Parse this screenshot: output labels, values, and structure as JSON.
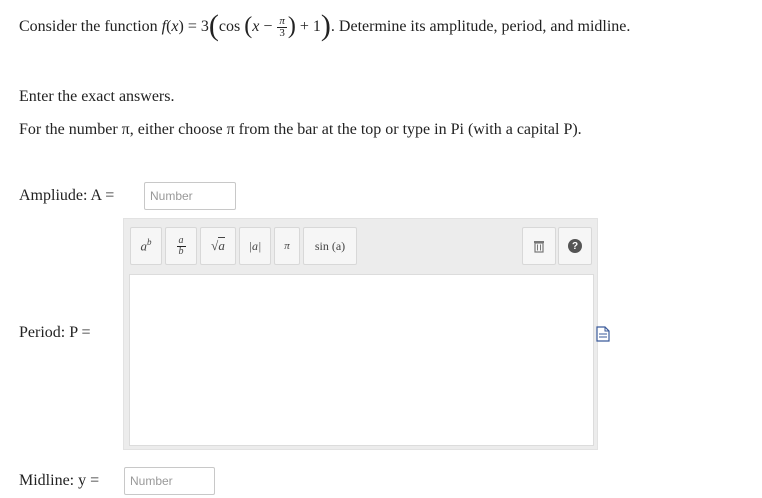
{
  "question": {
    "prefix": "Consider the function",
    "f": "f",
    "x": "x",
    "coef": "3",
    "cos": "cos",
    "minus": "−",
    "pi": "π",
    "den": "3",
    "plus_one": "+ 1",
    "suffix": ". Determine its amplitude, period, and midline."
  },
  "instructions": {
    "line1": "Enter the exact answers.",
    "line2": "For the number π, either choose π from the bar at the top or type in Pi (with a capital P)."
  },
  "amplitude": {
    "label": "Ampliude: A =",
    "placeholder": "Number"
  },
  "period": {
    "label": "Period: P ="
  },
  "midline": {
    "label": "Midline: y =",
    "placeholder": "Number"
  },
  "toolbar": {
    "buttons": [
      "a^b",
      "a/b",
      "√a",
      "|a|",
      "π",
      "sin (a)"
    ],
    "sin_label": "sin (a)",
    "pi_label": "π",
    "abs_label": "|a|",
    "help_label": "?"
  },
  "icons": [
    "superscript-icon",
    "fraction-icon",
    "sqrt-icon",
    "abs-value-icon",
    "pi-icon",
    "sin-icon",
    "trash-icon",
    "help-icon",
    "document-icon"
  ]
}
